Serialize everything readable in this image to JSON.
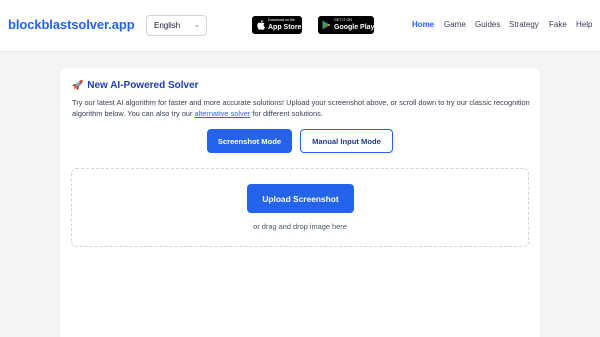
{
  "header": {
    "logo": "blockblastsolver.app",
    "language": {
      "selected": "English"
    },
    "app_store": {
      "small": "Download on the",
      "big": "App Store"
    },
    "google_play": {
      "small": "GET IT ON",
      "big": "Google Play"
    },
    "nav": [
      "Home",
      "Game",
      "Guides",
      "Strategy",
      "Fake",
      "Help"
    ],
    "active_nav": "Home"
  },
  "main": {
    "title_icon": "🚀",
    "title": "New AI-Powered Solver",
    "desc_part1": "Try our latest AI algorithm for faster and more accurate solutions! Upload your screenshot above, or scroll down to try our classic recognition algorithm below. You can also try our ",
    "desc_link": "alternative solver",
    "desc_part2": " for different solutions.",
    "screenshot_mode": "Screenshot Mode",
    "manual_mode": "Manual Input Mode",
    "upload_button": "Upload Screenshot",
    "drop_hint": "or drag and drop image here"
  },
  "colors": {
    "accent": "#2563eb",
    "title": "#1e40af"
  },
  "icons": [
    "apple-icon",
    "google-play-icon",
    "rocket-icon",
    "chevron-down-icon"
  ]
}
